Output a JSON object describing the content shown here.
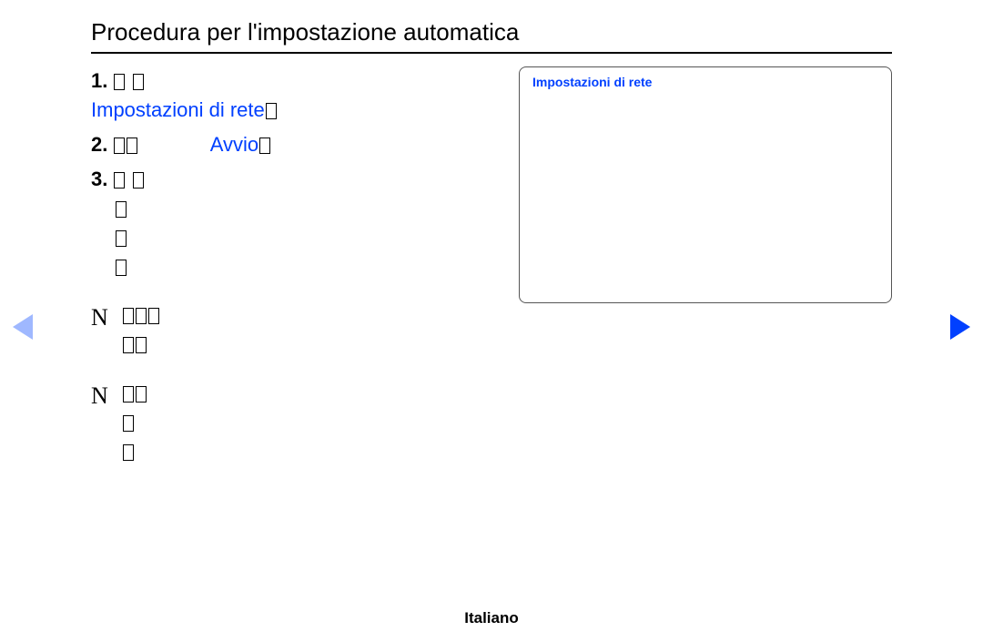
{
  "title": "Procedura per l'impostazione automatica",
  "steps": [
    {
      "num": "1.",
      "prefix_text": " ",
      "glyphs_prefix": 2,
      "line2_blue": "Impostazioni di rete",
      "line2_glyphs_after": 1
    },
    {
      "num": "2.",
      "glyphs_before": 2,
      "blue_text": "Avvio",
      "glyphs_after": 1
    },
    {
      "num": "3.",
      "lines_glyphs": [
        2,
        1,
        1,
        1
      ]
    }
  ],
  "panel": {
    "title": "Impostazioni di rete"
  },
  "notes": [
    {
      "mark": "N",
      "lines_glyphs": [
        3,
        2
      ]
    },
    {
      "mark": "N",
      "lines_glyphs": [
        2,
        1,
        1
      ]
    }
  ],
  "footer": "Italiano"
}
